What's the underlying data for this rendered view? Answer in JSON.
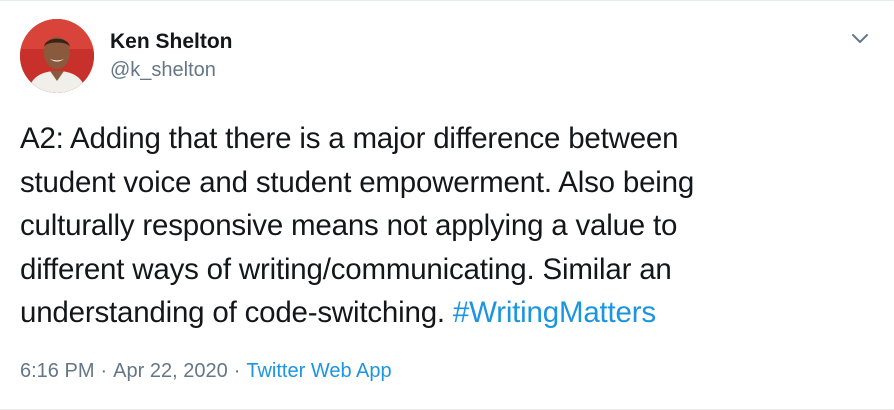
{
  "author": {
    "name": "Ken Shelton",
    "handle": "@k_shelton",
    "avatar_icon": "profile-photo"
  },
  "menu_icon": "chevron-down-icon",
  "tweet": {
    "line1": "A2: Adding that there is a major difference between",
    "line2": "student voice and student empowerment. Also being",
    "line3": "culturally responsive means not applying a value to",
    "line4": "different ways of writing/communicating. Similar an",
    "line5": "understanding of code-switching. ",
    "hashtag": "#WritingMatters"
  },
  "meta": {
    "time": "6:16 PM",
    "separator": "·",
    "date": "Apr 22, 2020",
    "source": "Twitter Web App"
  },
  "colors": {
    "link": "#1b95e0",
    "secondary_text": "#657786",
    "primary_text": "#14171a"
  }
}
